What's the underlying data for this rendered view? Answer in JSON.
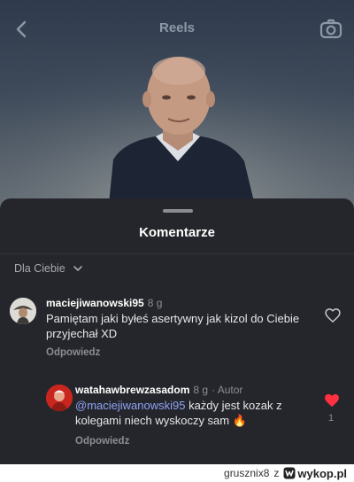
{
  "topbar": {
    "title": "Reels"
  },
  "sheet": {
    "title": "Komentarze",
    "sort_label": "Dla Ciebie"
  },
  "comments": [
    {
      "username": "maciejiwanowski95",
      "time": "8 g",
      "text": "Pamiętam jaki byłeś asertywny jak kizol do Ciebie przyjechał XD",
      "reply_label": "Odpowiedz"
    },
    {
      "username": "watahawbrewzasadom",
      "time": "8 g",
      "author_badge": "· Autor",
      "mention": "@maciejiwanowski95",
      "text": " każdy jest kozak z kolegami niech wyskoczy sam 🔥",
      "reply_label": "Odpowiedz",
      "like_count": "1"
    }
  ],
  "watermark": {
    "user": "grusznix8",
    "sep": "z",
    "site": "wykop.pl"
  },
  "colors": {
    "sheet": "#25262b",
    "mention": "#8ea3f5",
    "like": "#ff3040"
  }
}
